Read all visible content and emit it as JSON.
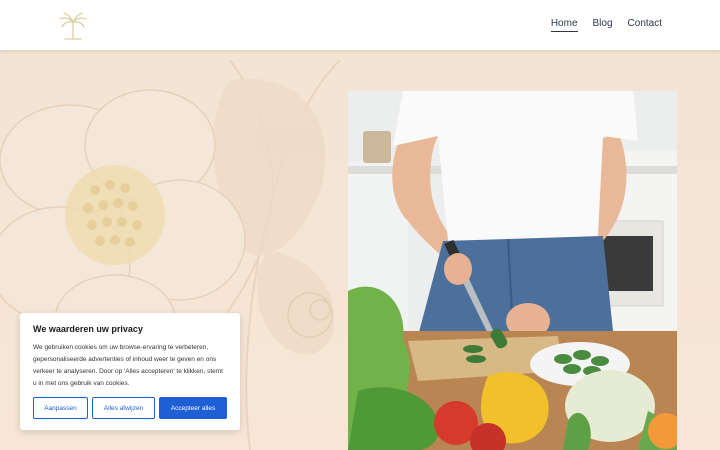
{
  "header": {
    "logo_icon": "palm-tree-logo-icon",
    "nav": [
      {
        "label": "Home",
        "active": true
      },
      {
        "label": "Blog",
        "active": false
      },
      {
        "label": "Contact",
        "active": false
      }
    ]
  },
  "hero": {
    "background_icon": "floral-illustration",
    "photo_icon": "person-cutting-vegetables-photo"
  },
  "cookie": {
    "title": "We waarderen uw privacy",
    "body": "We gebruiken cookies om uw browse-ervaring te verbeteren, gepersonaliseerde advertenties of inhoud weer te geven en ons verkeer te analyseren. Door op 'Alles accepteren' te klikken, stemt u in met ons gebruik van cookies.",
    "customize_label": "Aanpassen",
    "reject_label": "Alles afwijzen",
    "accept_label": "Accepteer alles"
  },
  "colors": {
    "accent": "#1e5fd6",
    "background": "#f6e4d2",
    "nav_text": "#2d3650"
  }
}
